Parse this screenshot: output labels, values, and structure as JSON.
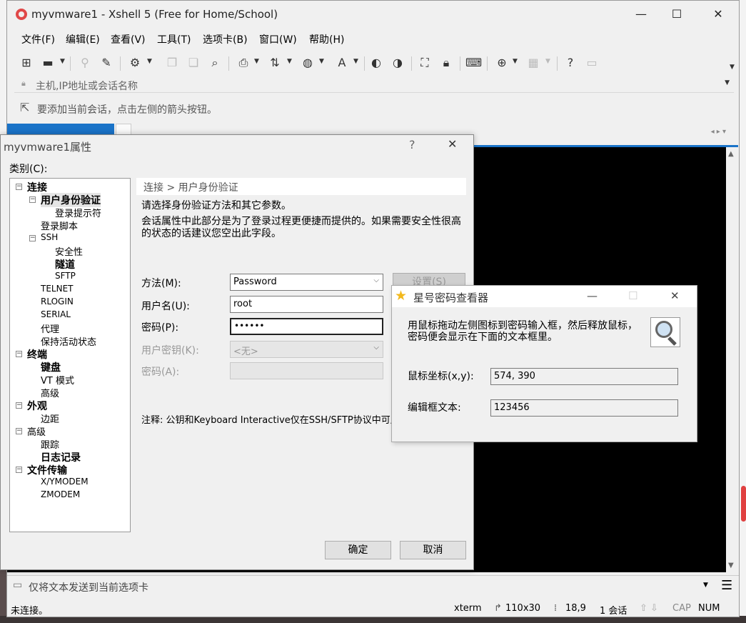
{
  "window": {
    "title": "myvmware1 - Xshell 5 (Free for Home/School)",
    "minimize": "—",
    "maximize": "☐",
    "close": "✕"
  },
  "menu": [
    "文件(F)",
    "编辑(E)",
    "查看(V)",
    "工具(T)",
    "选项卡(B)",
    "窗口(W)",
    "帮助(H)"
  ],
  "address": {
    "placeholder": "主机,IP地址或会话名称"
  },
  "linkbar": {
    "text": "要添加当前会话，点击左侧的箭头按钮。"
  },
  "compose": {
    "text": "仅将文本发送到当前选项卡"
  },
  "status": {
    "left": "未连接。",
    "term": "xterm",
    "size": "110x30",
    "pos": "18,9",
    "sessions": "1 会话",
    "cap": "CAP",
    "num": "NUM"
  },
  "props": {
    "title": "myvmware1属性",
    "help": "?",
    "close": "✕",
    "category_label": "类别(C):",
    "tree": [
      "连接",
      "用户身份验证",
      "登录提示符",
      "登录脚本",
      "SSH",
      "安全性",
      "隧道",
      "SFTP",
      "TELNET",
      "RLOGIN",
      "SERIAL",
      "代理",
      "保持活动状态",
      "终端",
      "键盘",
      "VT 模式",
      "高级",
      "外观",
      "边距",
      "高级",
      "跟踪",
      "日志记录",
      "文件传输",
      "X/YMODEM",
      "ZMODEM"
    ],
    "breadcrumb": "连接 > 用户身份验证",
    "desc1": "请选择身份验证方法和其它参数。",
    "desc2": "会话属性中此部分是为了登录过程更便捷而提供的。如果需要安全性很高的状态的话建议您空出此字段。",
    "method_label": "方法(M):",
    "method_value": "Password",
    "settings_button": "设置(S)",
    "user_label": "用户名(U):",
    "user_value": "root",
    "pass_label": "密码(P):",
    "pass_value": "••••••",
    "userkey_label": "用户密钥(K):",
    "userkey_value": "<无>",
    "passphrase_label": "密码(A):",
    "note": "注释: 公钥和Keyboard Interactive仅在SSH/SFTP协议中可用",
    "ok": "确定",
    "cancel": "取消"
  },
  "viewer": {
    "title": "星号密码查看器",
    "desc": "用鼠标拖动左侧图标到密码输入框，然后释放鼠标，密码便会显示在下面的文本框里。",
    "coord_label": "鼠标坐标(x,y):",
    "coord_value": "574, 390",
    "text_label": "编辑框文本:",
    "text_value": "123456",
    "minimize": "—",
    "maximize": "☐",
    "close": "✕"
  }
}
